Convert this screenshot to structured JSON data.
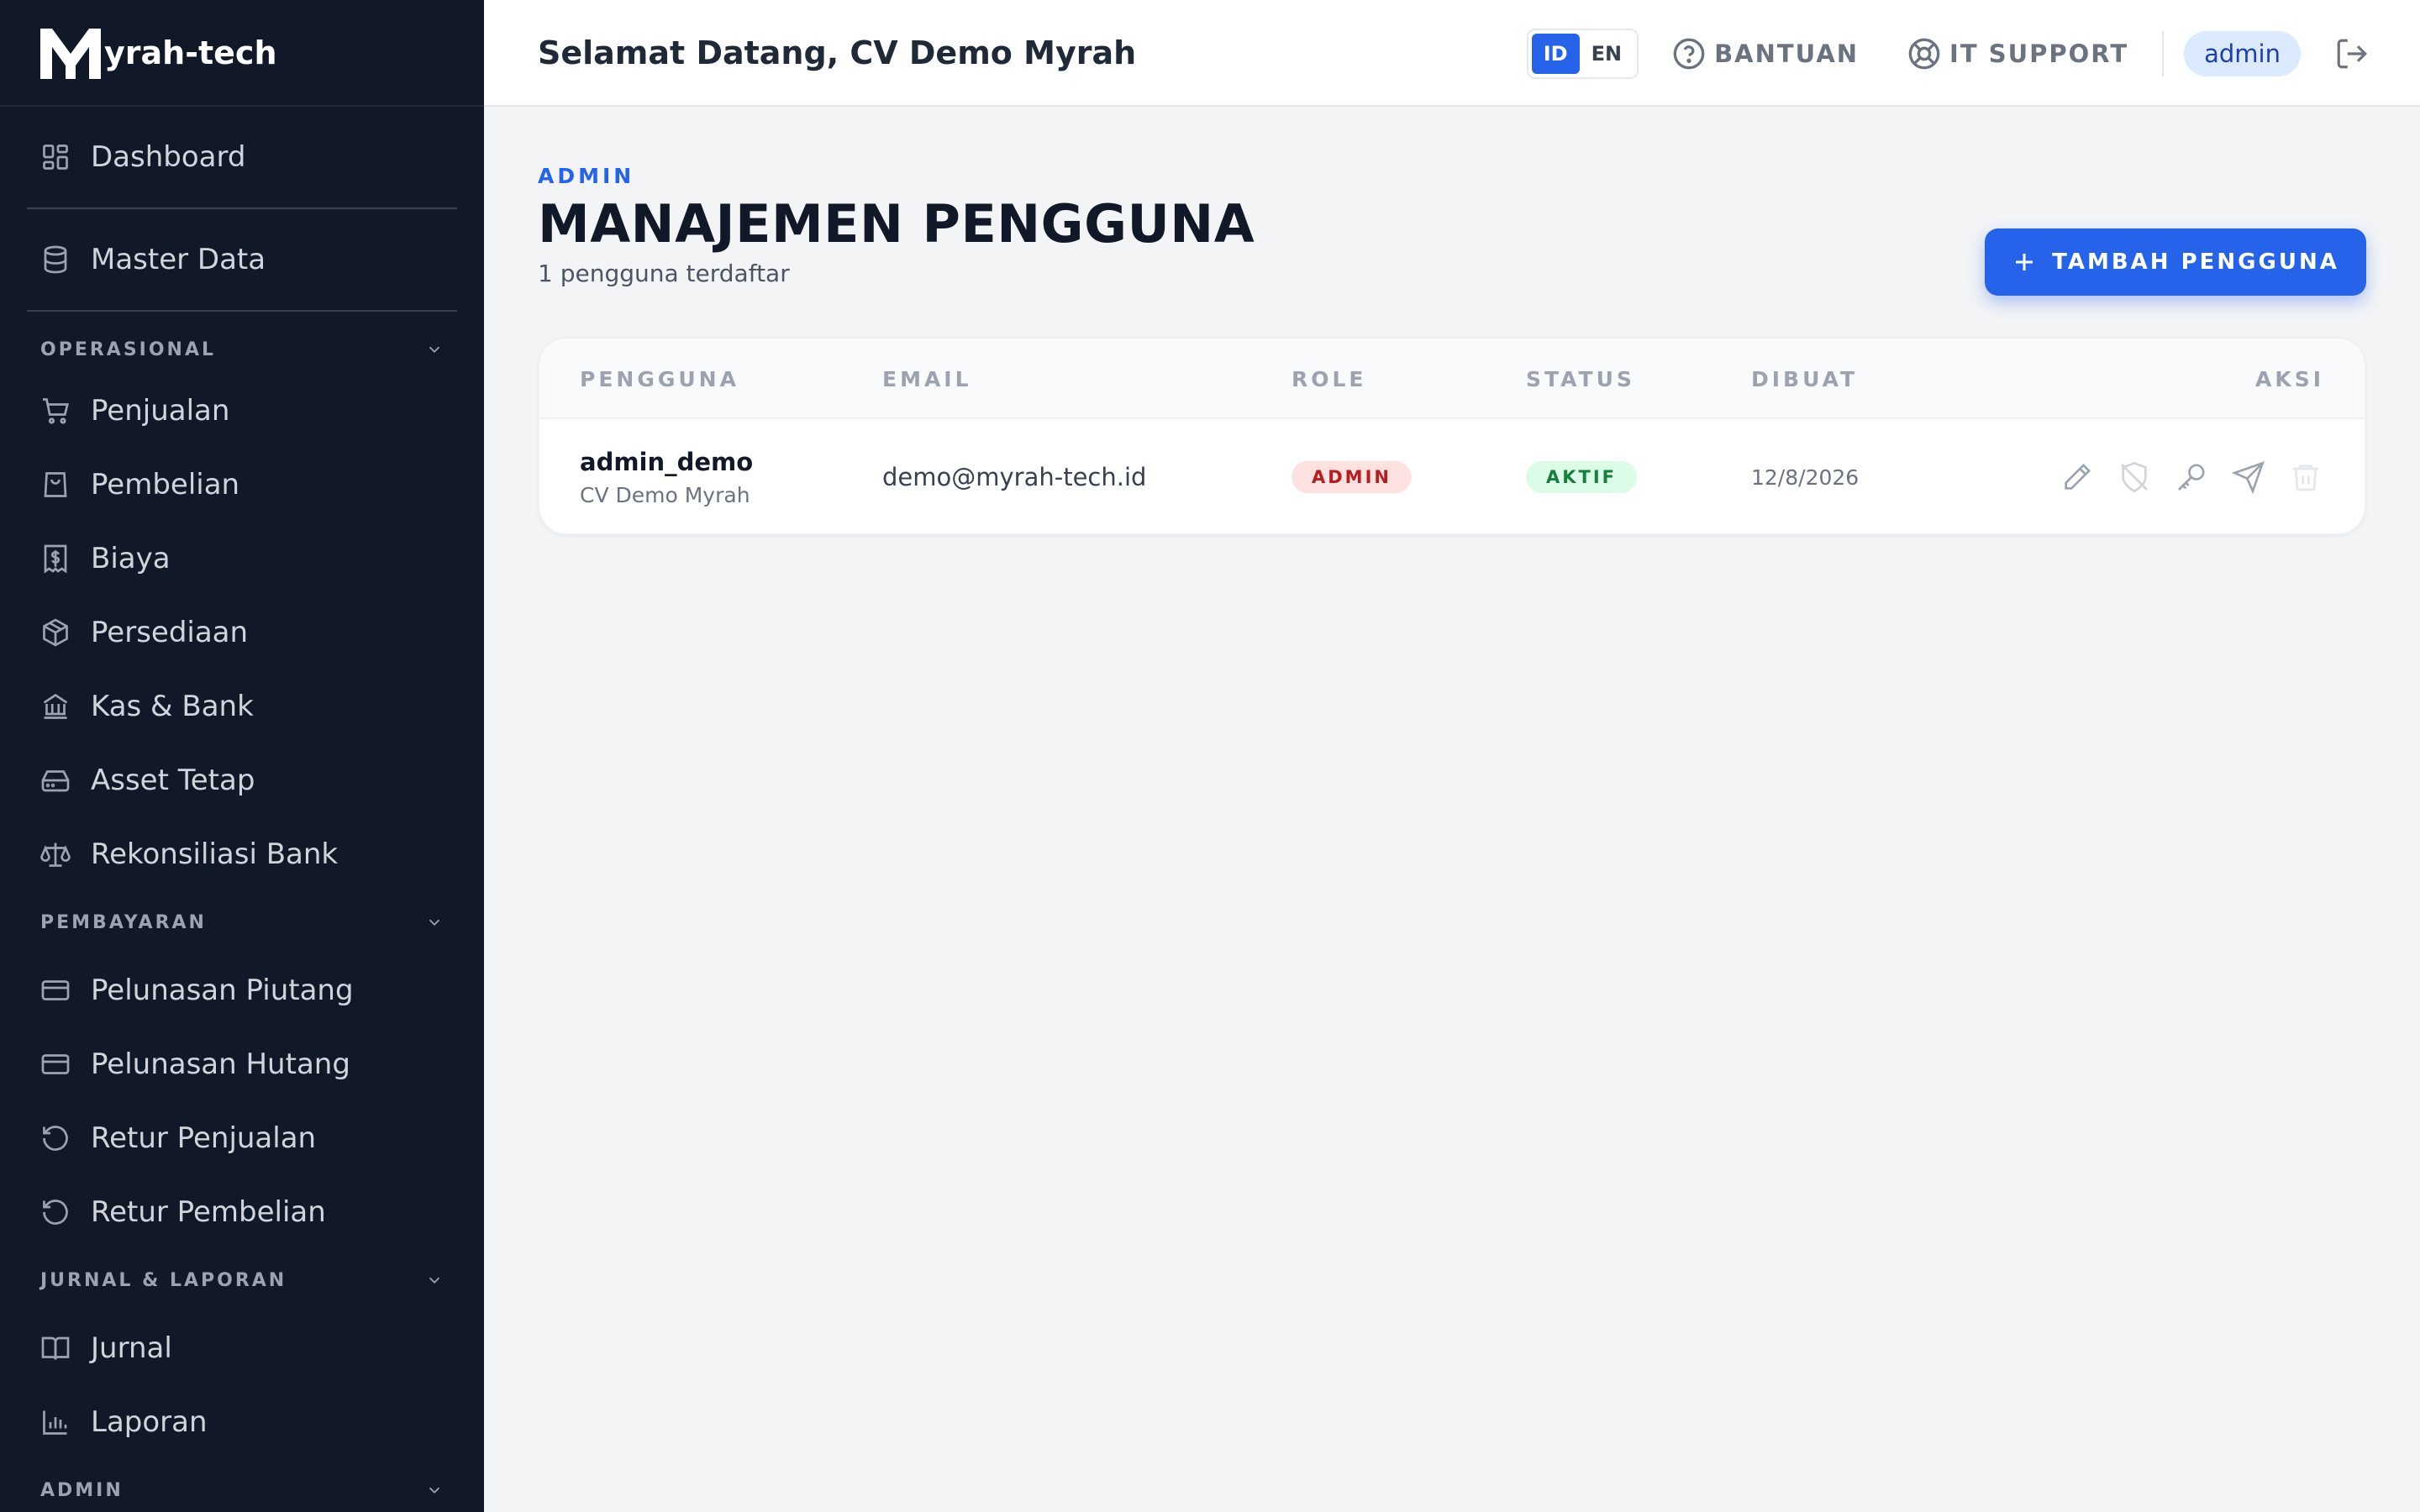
{
  "brand": {
    "name": "yrah-tech",
    "logo_letter": "M"
  },
  "sidebar": {
    "top_items": [
      {
        "label": "Dashboard",
        "icon": "dashboard-icon"
      },
      {
        "label": "Master Data",
        "icon": "database-icon"
      }
    ],
    "sections": [
      {
        "title": "OPERASIONAL",
        "items": [
          {
            "label": "Penjualan",
            "icon": "cart-icon"
          },
          {
            "label": "Pembelian",
            "icon": "shopping-bag-icon"
          },
          {
            "label": "Biaya",
            "icon": "receipt-icon"
          },
          {
            "label": "Persediaan",
            "icon": "package-icon"
          },
          {
            "label": "Kas & Bank",
            "icon": "bank-icon"
          },
          {
            "label": "Asset Tetap",
            "icon": "hard-drive-icon"
          },
          {
            "label": "Rekonsiliasi Bank",
            "icon": "scale-icon"
          }
        ]
      },
      {
        "title": "PEMBAYARAN",
        "items": [
          {
            "label": "Pelunasan Piutang",
            "icon": "credit-card-icon"
          },
          {
            "label": "Pelunasan Hutang",
            "icon": "credit-card-icon"
          },
          {
            "label": "Retur Penjualan",
            "icon": "rotate-ccw-icon"
          },
          {
            "label": "Retur Pembelian",
            "icon": "rotate-ccw-icon"
          }
        ]
      },
      {
        "title": "JURNAL & LAPORAN",
        "items": [
          {
            "label": "Jurnal",
            "icon": "book-icon"
          },
          {
            "label": "Laporan",
            "icon": "bar-chart-icon"
          }
        ]
      },
      {
        "title": "ADMIN",
        "items": []
      }
    ]
  },
  "topbar": {
    "welcome": "Selamat Datang, CV Demo Myrah",
    "lang_options": [
      "ID",
      "EN"
    ],
    "lang_active": "ID",
    "help_label": "BANTUAN",
    "support_label": "IT SUPPORT",
    "user": "admin"
  },
  "page": {
    "crumb": "ADMIN",
    "title": "MANAJEMEN PENGGUNA",
    "subtitle": "1 pengguna terdaftar",
    "add_button": "TAMBAH PENGGUNA"
  },
  "table": {
    "headers": {
      "user": "PENGGUNA",
      "email": "EMAIL",
      "role": "ROLE",
      "status": "STATUS",
      "created": "DIBUAT",
      "actions": "AKSI"
    },
    "rows": [
      {
        "username": "admin_demo",
        "company": "CV Demo Myrah",
        "email": "demo@myrah-tech.id",
        "role": "ADMIN",
        "status": "AKTIF",
        "created": "12/8/2026"
      }
    ]
  },
  "colors": {
    "sidebar_bg": "#111827",
    "accent": "#2563eb",
    "role_badge": "#b91c1c",
    "status_badge": "#15803d"
  }
}
